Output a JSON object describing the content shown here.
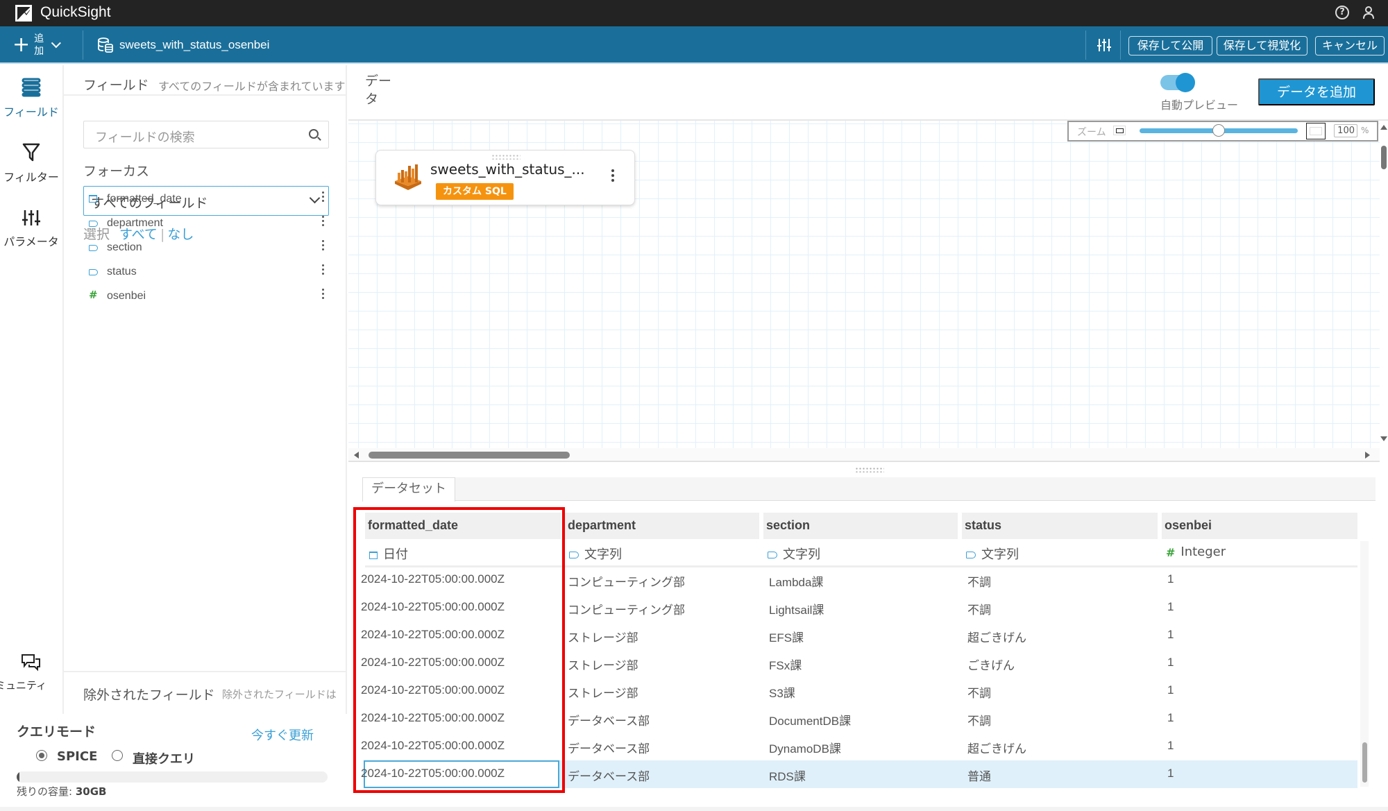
{
  "app": {
    "brand": "QuickSight"
  },
  "topbar": {
    "help_icon": "help-circle-icon",
    "user_icon": "user-icon"
  },
  "toolbar": {
    "add_label": "追加",
    "dataset_name": "sweets_with_status_osenbei",
    "save_publish": "保存して公開",
    "save_visualize": "保存して視覚化",
    "cancel": "キャンセル"
  },
  "leftnav": {
    "items": [
      {
        "label": "フィールド",
        "icon": "fields-stack-icon",
        "active": true
      },
      {
        "label": "フィルター",
        "icon": "filter-funnel-icon"
      },
      {
        "label": "パラメータ",
        "icon": "sliders-icon"
      },
      {
        "label": "コミュニティ",
        "icon": "community-chat-icon"
      }
    ]
  },
  "fields_panel": {
    "title": "フィールド",
    "subtitle": "すべてのフィールドが含まれています",
    "search_placeholder": "フィールドの検索",
    "focus_label": "フォーカス",
    "focus_value": "すべてのフィールド",
    "select_label": "選択",
    "select_all": "すべて",
    "select_none": "なし",
    "separator": "|",
    "fields": [
      {
        "name": "formatted_date",
        "type": "date"
      },
      {
        "name": "department",
        "type": "string"
      },
      {
        "name": "section",
        "type": "string"
      },
      {
        "name": "status",
        "type": "string"
      },
      {
        "name": "osenbei",
        "type": "number"
      }
    ],
    "excluded_title": "除外されたフィールド",
    "excluded_subtitle": "除外されたフィールドは"
  },
  "query_mode": {
    "title": "クエリモード",
    "refresh": "今すぐ更新",
    "options": [
      "SPICE",
      "直接クエリ"
    ],
    "selected": "SPICE",
    "capacity_label": "残りの容量:",
    "capacity_value": "30GB",
    "capacity_used_fraction": 0.01
  },
  "data_area": {
    "title": "データ",
    "auto_preview_label": "自動プレビュー",
    "auto_preview_on": true,
    "add_data": "データを追加",
    "zoom_label": "ズーム",
    "zoom_value": "100",
    "zoom_unit": "%",
    "zoom_slider_fraction": 0.5,
    "card": {
      "name": "sweets_with_status_...",
      "badge": "カスタム SQL"
    }
  },
  "dataset_tab": "データセット",
  "table": {
    "columns": [
      {
        "name": "formatted_date",
        "type_label": "日付",
        "type": "date"
      },
      {
        "name": "department",
        "type_label": "文字列",
        "type": "string"
      },
      {
        "name": "section",
        "type_label": "文字列",
        "type": "string"
      },
      {
        "name": "status",
        "type_label": "文字列",
        "type": "string"
      },
      {
        "name": "osenbei",
        "type_label": "Integer",
        "type": "number"
      }
    ],
    "rows": [
      [
        "2024-10-22T05:00:00.000Z",
        "コンピューティング部",
        "Lambda課",
        "不調",
        "1"
      ],
      [
        "2024-10-22T05:00:00.000Z",
        "コンピューティング部",
        "Lightsail課",
        "不調",
        "1"
      ],
      [
        "2024-10-22T05:00:00.000Z",
        "ストレージ部",
        "EFS課",
        "超ごきげん",
        "1"
      ],
      [
        "2024-10-22T05:00:00.000Z",
        "ストレージ部",
        "FSx課",
        "ごきげん",
        "1"
      ],
      [
        "2024-10-22T05:00:00.000Z",
        "ストレージ部",
        "S3課",
        "不調",
        "1"
      ],
      [
        "2024-10-22T05:00:00.000Z",
        "データベース部",
        "DocumentDB課",
        "不調",
        "1"
      ],
      [
        "2024-10-22T05:00:00.000Z",
        "データベース部",
        "DynamoDB課",
        "超ごきげん",
        "1"
      ],
      [
        "2024-10-22T05:00:00.000Z",
        "データベース部",
        "RDS課",
        "普通",
        "1"
      ]
    ],
    "selected_row": 7
  },
  "colors": {
    "topbar": "#232323",
    "toolbar": "#1a6f9a",
    "accent": "#1f96d3",
    "badge": "#f5930f",
    "highlight": "#ee0000",
    "selected_row": "#dff0fa"
  }
}
